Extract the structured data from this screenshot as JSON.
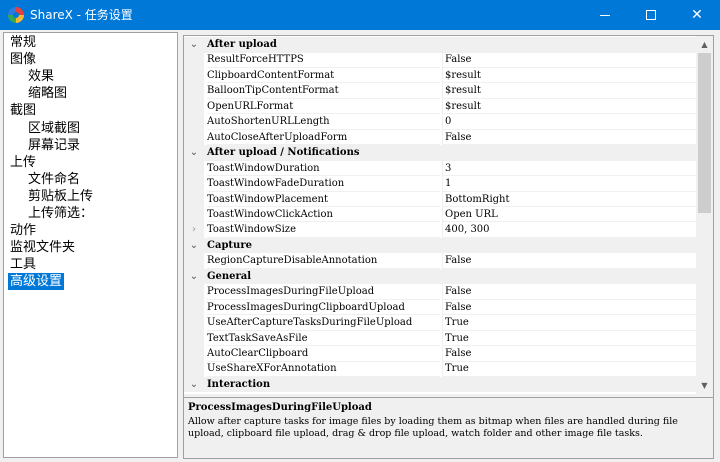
{
  "window": {
    "title": "ShareX - 任务设置",
    "minimize_label": "minimize",
    "maximize_label": "maximize",
    "close_label": "close"
  },
  "nav": {
    "items": [
      {
        "label": "常规",
        "level": 0
      },
      {
        "label": "图像",
        "level": 0
      },
      {
        "label": "效果",
        "level": 1
      },
      {
        "label": "缩略图",
        "level": 1
      },
      {
        "label": "截图",
        "level": 0
      },
      {
        "label": "区域截图",
        "level": 1
      },
      {
        "label": "屏幕记录",
        "level": 1
      },
      {
        "label": "上传",
        "level": 0
      },
      {
        "label": "文件命名",
        "level": 1
      },
      {
        "label": "剪贴板上传",
        "level": 1
      },
      {
        "label": "上传筛选：",
        "level": 1
      },
      {
        "label": "动作",
        "level": 0
      },
      {
        "label": "监视文件夹",
        "level": 0
      },
      {
        "label": "工具",
        "level": 0
      },
      {
        "label": "高级设置",
        "level": 0,
        "selected": true
      }
    ]
  },
  "grid": {
    "rows": [
      {
        "type": "category",
        "name": "After upload"
      },
      {
        "type": "prop",
        "name": "ResultForceHTTPS",
        "value": "False"
      },
      {
        "type": "prop",
        "name": "ClipboardContentFormat",
        "value": "$result"
      },
      {
        "type": "prop",
        "name": "BalloonTipContentFormat",
        "value": "$result"
      },
      {
        "type": "prop",
        "name": "OpenURLFormat",
        "value": "$result"
      },
      {
        "type": "prop",
        "name": "AutoShortenURLLength",
        "value": "0"
      },
      {
        "type": "prop",
        "name": "AutoCloseAfterUploadForm",
        "value": "False"
      },
      {
        "type": "category",
        "name": "After upload / Notifications"
      },
      {
        "type": "prop",
        "name": "ToastWindowDuration",
        "value": "3"
      },
      {
        "type": "prop",
        "name": "ToastWindowFadeDuration",
        "value": "1"
      },
      {
        "type": "prop",
        "name": "ToastWindowPlacement",
        "value": "BottomRight"
      },
      {
        "type": "prop",
        "name": "ToastWindowClickAction",
        "value": "Open URL"
      },
      {
        "type": "prop",
        "name": "ToastWindowSize",
        "value": "400, 300",
        "expandable": true
      },
      {
        "type": "category",
        "name": "Capture"
      },
      {
        "type": "prop",
        "name": "RegionCaptureDisableAnnotation",
        "value": "False"
      },
      {
        "type": "category",
        "name": "General"
      },
      {
        "type": "prop",
        "name": "ProcessImagesDuringFileUpload",
        "value": "False"
      },
      {
        "type": "prop",
        "name": "ProcessImagesDuringClipboardUpload",
        "value": "False"
      },
      {
        "type": "prop",
        "name": "UseAfterCaptureTasksDuringFileUpload",
        "value": "True"
      },
      {
        "type": "prop",
        "name": "TextTaskSaveAsFile",
        "value": "True"
      },
      {
        "type": "prop",
        "name": "AutoClearClipboard",
        "value": "False"
      },
      {
        "type": "prop",
        "name": "UseShareXForAnnotation",
        "value": "True"
      },
      {
        "type": "category",
        "name": "Interaction"
      }
    ]
  },
  "description": {
    "title": "ProcessImagesDuringFileUpload",
    "text": "Allow after capture tasks for image files by loading them as bitmap when files are handled during file upload, clipboard file upload, drag & drop file upload, watch folder and other image file tasks."
  }
}
